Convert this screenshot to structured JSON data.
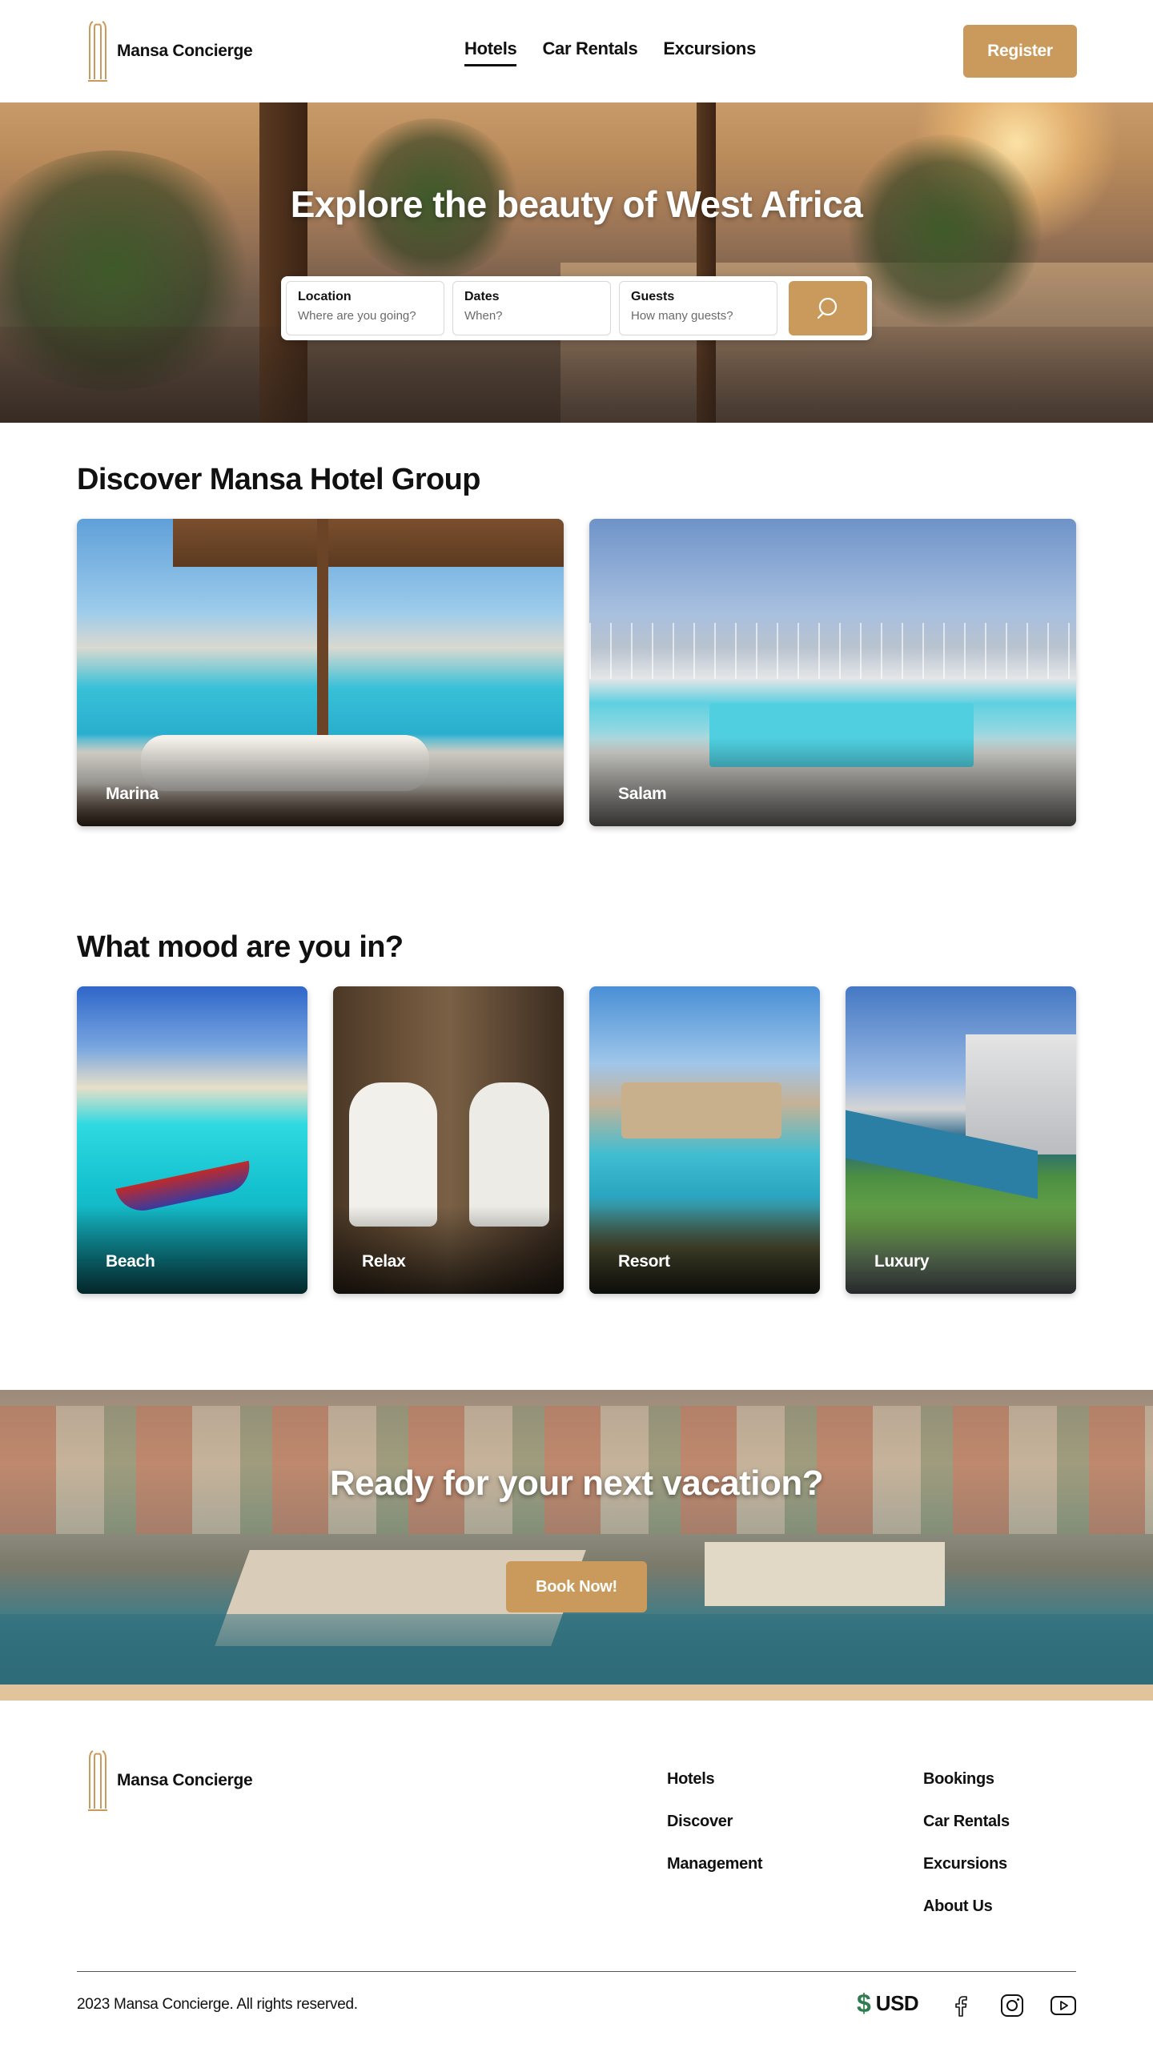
{
  "brand": {
    "name": "Mansa Concierge",
    "logo_icon": "columns-logo-icon",
    "accent_color": "#c99a5b"
  },
  "nav": {
    "items": [
      {
        "label": "Hotels",
        "active": true
      },
      {
        "label": "Car Rentals",
        "active": false
      },
      {
        "label": "Excursions",
        "active": false
      }
    ],
    "register_label": "Register"
  },
  "hero": {
    "title": "Explore the beauty of West Africa",
    "search": {
      "location_label": "Location",
      "location_placeholder": "Where are you going?",
      "dates_label": "Dates",
      "dates_placeholder": "When?",
      "guests_label": "Guests",
      "guests_placeholder": "How many guests?",
      "button_icon": "search-icon"
    }
  },
  "hotels": {
    "title": "Discover Mansa Hotel Group",
    "cards": [
      {
        "label": "Marina"
      },
      {
        "label": "Salam"
      }
    ]
  },
  "moods": {
    "title": "What mood are you in?",
    "cards": [
      {
        "label": "Beach"
      },
      {
        "label": "Relax"
      },
      {
        "label": "Resort"
      },
      {
        "label": "Luxury"
      }
    ]
  },
  "cta": {
    "title": "Ready for your next vacation?",
    "button_label": "Book Now!"
  },
  "footer": {
    "col1": [
      "Hotels",
      "Discover",
      "Management"
    ],
    "col2": [
      "Bookings",
      "Car Rentals",
      "Excursions",
      "About Us"
    ],
    "copyright": "2023 Mansa Concierge. All rights reserved.",
    "currency": {
      "symbol": "$",
      "code": "USD",
      "color": "#2e7d4f"
    },
    "social_icons": [
      "facebook-icon",
      "instagram-icon",
      "youtube-icon"
    ]
  }
}
